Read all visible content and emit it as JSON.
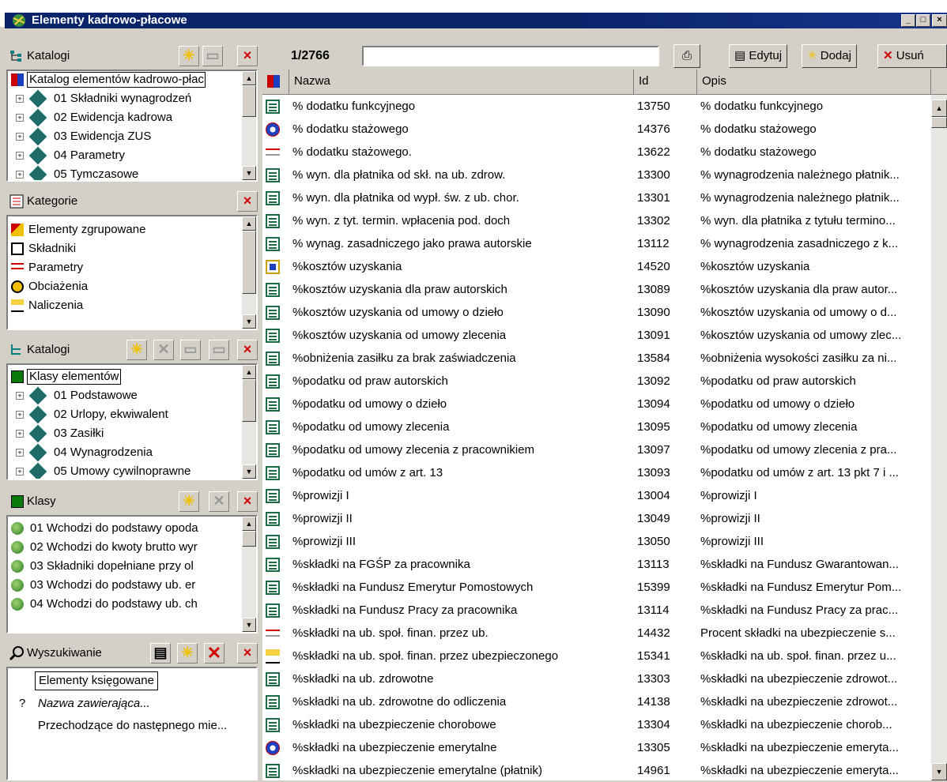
{
  "window": {
    "title": "Elementy kadrowo-płacowe",
    "min": "_",
    "max": "□",
    "close": "×"
  },
  "panels": {
    "katalogi1": {
      "label": "Katalogi",
      "items": [
        {
          "label": "Katalog elementów kadrowo-płac",
          "icon": "catalog-root-icon"
        },
        {
          "label": "01 Składniki wynagrodzeń",
          "icon": "folder-diamond-icon"
        },
        {
          "label": "02 Ewidencja kadrowa",
          "icon": "folder-diamond-icon"
        },
        {
          "label": "03 Ewidencja ZUS",
          "icon": "folder-diamond-icon"
        },
        {
          "label": "04 Parametry",
          "icon": "folder-diamond-icon"
        },
        {
          "label": "05 Tymczasowe",
          "icon": "folder-diamond-icon"
        }
      ]
    },
    "kategorie": {
      "label": "Kategorie",
      "items": [
        {
          "label": "Elementy zgrupowane",
          "icon": "group-icon"
        },
        {
          "label": "Składniki",
          "icon": "component-icon"
        },
        {
          "label": "Parametry",
          "icon": "parameter-icon"
        },
        {
          "label": "Obciażenia",
          "icon": "burden-icon"
        },
        {
          "label": "Naliczenia",
          "icon": "accrual-icon"
        }
      ]
    },
    "katalogi2": {
      "label": "Katalogi",
      "items": [
        {
          "label": "Klasy elementów",
          "icon": "class-icon"
        },
        {
          "label": "01 Podstawowe",
          "icon": "folder-diamond-icon"
        },
        {
          "label": "02 Urlopy, ekwiwalent",
          "icon": "folder-diamond-icon"
        },
        {
          "label": "03 Zasiłki",
          "icon": "folder-diamond-icon"
        },
        {
          "label": "04 Wynagrodzenia",
          "icon": "folder-diamond-icon"
        },
        {
          "label": "05 Umowy cywilnoprawne",
          "icon": "folder-diamond-icon"
        }
      ]
    },
    "klasy": {
      "label": "Klasy",
      "items": [
        {
          "label": "01 Wchodzi do podstawy opoda"
        },
        {
          "label": "02 Wchodzi do kwoty brutto wyr"
        },
        {
          "label": "03 Składniki dopełniane przy ol"
        },
        {
          "label": "03 Wchodzi do podstawy ub. er"
        },
        {
          "label": "04 Wchodzi do podstawy ub. ch"
        }
      ]
    },
    "wyszukiwanie": {
      "label": "Wyszukiwanie",
      "items": [
        {
          "label": "Elementy księgowane",
          "prefix": ""
        },
        {
          "label": "Nazwa zawierająca...",
          "prefix": "?"
        },
        {
          "label": "Przechodzące do następnego mie...",
          "prefix": ""
        }
      ]
    }
  },
  "toolbar": {
    "counter": "1/2766",
    "search_value": "",
    "edit": "Edytuj",
    "add": "Dodaj",
    "delete": "Usuń"
  },
  "grid": {
    "columns": [
      "Nazwa",
      "Id",
      "Opis"
    ],
    "rows": [
      {
        "icon": "note",
        "name": "% dodatku funkcyjnego",
        "id": "13750",
        "opis": "% dodatku funkcyjnego"
      },
      {
        "icon": "globe",
        "name": "% dodatku stażowego",
        "id": "14376",
        "opis": "% dodatku stażowego"
      },
      {
        "icon": "param",
        "name": "% dodatku stażowego.",
        "id": "13622",
        "opis": "% dodatku stażowego"
      },
      {
        "icon": "note",
        "name": "% wyn. dla płatnika od skł. na ub. zdrow.",
        "id": "13300",
        "opis": "% wynagrodzenia należnego płatnik..."
      },
      {
        "icon": "note",
        "name": "% wyn. dla płatnika od wypł. św. z ub. chor.",
        "id": "13301",
        "opis": "% wynagrodzenia należnego płatnik..."
      },
      {
        "icon": "note",
        "name": "% wyn. z tyt. termin. wpłacenia pod. doch",
        "id": "13302",
        "opis": "% wyn. dla płatnika z tytułu termino..."
      },
      {
        "icon": "note",
        "name": "% wynag. zasadniczego jako prawa autorskie",
        "id": "13112",
        "opis": "% wynagrodzenia zasadniczego z k..."
      },
      {
        "icon": "multi",
        "name": "%kosztów uzyskania",
        "id": "14520",
        "opis": "%kosztów uzyskania"
      },
      {
        "icon": "note",
        "name": "%kosztów uzyskania dla praw autorskich",
        "id": "13089",
        "opis": "%kosztów uzyskania dla praw autor..."
      },
      {
        "icon": "note",
        "name": "%kosztów uzyskania od umowy o dzieło",
        "id": "13090",
        "opis": "%kosztów uzyskania od umowy o d..."
      },
      {
        "icon": "note",
        "name": "%kosztów uzyskania od umowy zlecenia",
        "id": "13091",
        "opis": "%kosztów uzyskania od umowy zlec..."
      },
      {
        "icon": "note",
        "name": "%obniżenia zasiłku za brak zaświadczenia",
        "id": "13584",
        "opis": "%obniżenia wysokości zasiłku za ni..."
      },
      {
        "icon": "note",
        "name": "%podatku od praw autorskich",
        "id": "13092",
        "opis": "%podatku od praw autorskich"
      },
      {
        "icon": "note",
        "name": "%podatku od umowy o dzieło",
        "id": "13094",
        "opis": "%podatku od umowy o dzieło"
      },
      {
        "icon": "note",
        "name": "%podatku od umowy zlecenia",
        "id": "13095",
        "opis": "%podatku od umowy zlecenia"
      },
      {
        "icon": "note",
        "name": "%podatku od umowy zlecenia z pracownikiem",
        "id": "13097",
        "opis": "%podatku od umowy zlecenia z pra..."
      },
      {
        "icon": "note",
        "name": "%podatku od umów z art. 13",
        "id": "13093",
        "opis": "%podatku od umów z art. 13 pkt 7 i ..."
      },
      {
        "icon": "note",
        "name": "%prowizji I",
        "id": "13004",
        "opis": "%prowizji I"
      },
      {
        "icon": "note",
        "name": "%prowizji II",
        "id": "13049",
        "opis": "%prowizji II"
      },
      {
        "icon": "note",
        "name": "%prowizji III",
        "id": "13050",
        "opis": "%prowizji III"
      },
      {
        "icon": "note",
        "name": "%składki na FGŚP za pracownika",
        "id": "13113",
        "opis": "%składki na Fundusz Gwarantowan..."
      },
      {
        "icon": "note",
        "name": "%składki na Fundusz Emerytur Pomostowych",
        "id": "15399",
        "opis": "%składki na Fundusz Emerytur Pom..."
      },
      {
        "icon": "note",
        "name": "%składki na Fundusz Pracy za pracownika",
        "id": "13114",
        "opis": "%składki na Fundusz Pracy za prac..."
      },
      {
        "icon": "param",
        "name": "%składki na ub. społ. finan. przez ub.",
        "id": "14432",
        "opis": "Procent składki na ubezpieczenie s..."
      },
      {
        "icon": "accrual",
        "name": "%składki na ub. społ. finan. przez ubezpieczonego",
        "id": "15341",
        "opis": "%składki na ub. społ. finan. przez u..."
      },
      {
        "icon": "note",
        "name": "%składki na ub. zdrowotne",
        "id": "13303",
        "opis": "%składki na ubezpieczenie zdrowot..."
      },
      {
        "icon": "note",
        "name": "%składki na ub. zdrowotne do odliczenia",
        "id": "14138",
        "opis": "%składki na ubezpieczenie zdrowot..."
      },
      {
        "icon": "note",
        "name": "%składki na ubezpieczenie chorobowe",
        "id": "13304",
        "opis": "%składki na ubezpieczenie chorob..."
      },
      {
        "icon": "globe",
        "name": "%składki na ubezpieczenie emerytalne",
        "id": "13305",
        "opis": "%składki na ubezpieczenie emeryta..."
      },
      {
        "icon": "note",
        "name": "%składki na ubezpieczenie emerytalne (płatnik)",
        "id": "14961",
        "opis": "%składki na ubezpieczenie emeryta..."
      }
    ]
  }
}
